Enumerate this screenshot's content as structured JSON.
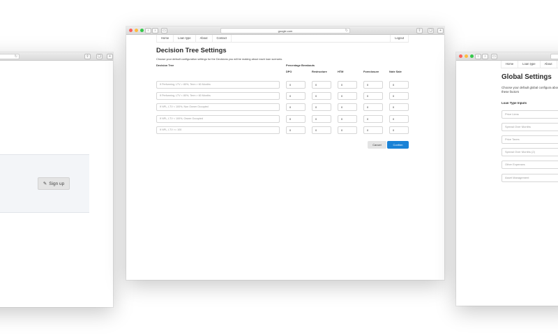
{
  "left_window": {
    "url_reload_icon": "reload-icon",
    "signup_label": "Sign up",
    "signup_icon": "edit-icon"
  },
  "main_window": {
    "url": "google.com",
    "nav": {
      "home": "Home",
      "loan_type": "Loan type",
      "about": "About",
      "contact": "Contact",
      "logout": "Logout"
    },
    "title": "Decision Tree Settings",
    "subtitle": "Choose your default configuration settings for the Decisions you will be making about each loan scenario.",
    "decision_tree_header": "Decision Tree",
    "percentage_header": "Percentage Breakouts",
    "columns": [
      "DPO",
      "Restructure",
      "HTM",
      "Foreclosure",
      "Note Sale"
    ],
    "rows": [
      {
        "placeholder": "If Performing, LTV > 80%, Term > 60 Months",
        "values": [
          "0",
          "0",
          "0",
          "0",
          "0"
        ]
      },
      {
        "placeholder": "If Performing, LTV < 80%, Term > 60 Months",
        "values": [
          "0",
          "0",
          "0",
          "0",
          "0"
        ]
      },
      {
        "placeholder": "If NPL, LTV < 100%, Non Owner Occupied",
        "values": [
          "0",
          "0",
          "0",
          "0",
          "0"
        ]
      },
      {
        "placeholder": "If NPL, LTV < 100%, Owner Occupied",
        "values": [
          "0",
          "0",
          "0",
          "0",
          "0"
        ]
      },
      {
        "placeholder": "If NPL, LTV >= 100",
        "values": [
          "0",
          "0",
          "0",
          "0",
          "0"
        ]
      }
    ],
    "cancel_label": "Cancel",
    "confirm_label": "Confirm"
  },
  "right_window": {
    "nav": {
      "home": "Home",
      "loan_type": "Loan type",
      "about": "About"
    },
    "title": "Global Settings",
    "subtitle": "Choose your default global configura about each loan with these factors",
    "section": "Loan Type Inputs",
    "inputs": [
      "Price Liens",
      "Spread Over Months",
      "Price Taxes",
      "Spread Over Months (2)",
      "Other Expenses",
      "Asset Management"
    ]
  },
  "colors": {
    "accent": "#1a82d6",
    "panel": "#f3f5f8"
  }
}
